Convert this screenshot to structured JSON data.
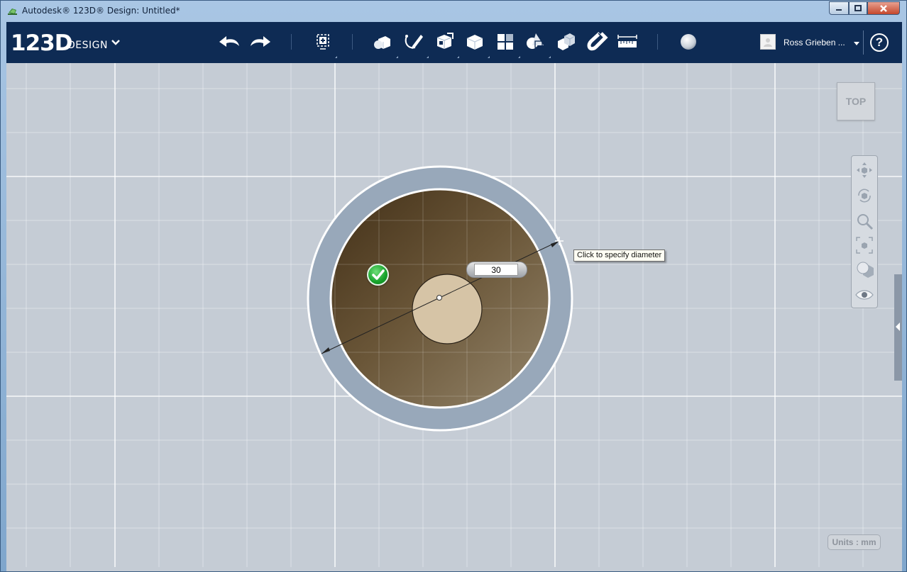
{
  "window": {
    "title": "Autodesk® 123D® Design: Untitled*",
    "controls": {
      "minimize": "minimize",
      "maximize": "maximize",
      "close": "close"
    }
  },
  "toolbar": {
    "logo_number": "123D",
    "logo_word": "DESIGN",
    "tools": [
      {
        "name": "undo"
      },
      {
        "name": "redo"
      },
      {
        "name": "transform"
      },
      {
        "name": "primitives"
      },
      {
        "name": "sketch"
      },
      {
        "name": "construct"
      },
      {
        "name": "modify"
      },
      {
        "name": "pattern"
      },
      {
        "name": "grouping"
      },
      {
        "name": "combine"
      },
      {
        "name": "snap"
      },
      {
        "name": "measure"
      },
      {
        "name": "material"
      }
    ],
    "user_name": "Ross Grieben ...",
    "help_label": "?"
  },
  "viewport": {
    "view_cube_label": "TOP",
    "nav_tools": [
      "pan",
      "orbit",
      "zoom",
      "fit",
      "views",
      "visibility"
    ],
    "units_label": "Units : mm",
    "tooltip": "Click to specify diameter",
    "diameter_value": "30",
    "colors": {
      "grid_bg": "#c5ccd5",
      "cylinder_dark": "#5a4428",
      "cylinder_light": "#8a7a5e",
      "ring": "#98a8ba",
      "hole": "#d6c4a6",
      "confirm": "#1fa534"
    }
  }
}
